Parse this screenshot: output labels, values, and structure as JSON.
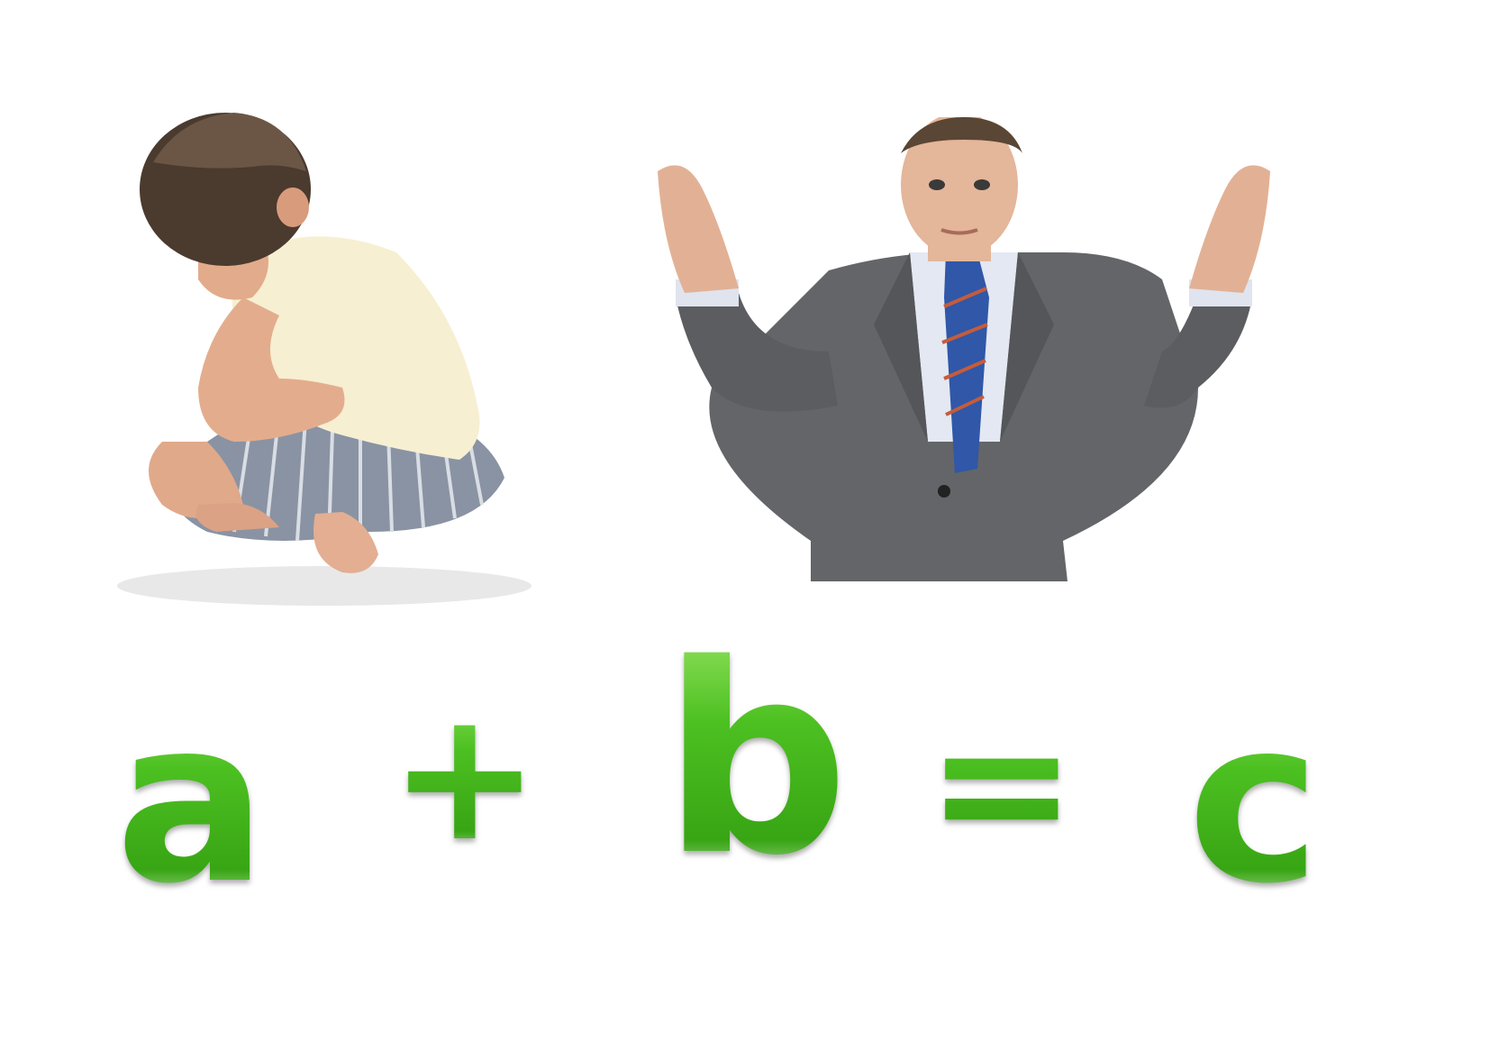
{
  "equation": {
    "a": "a",
    "plus": "+",
    "b": "b",
    "equals": "=",
    "c": "c"
  },
  "colors": {
    "symbol_green": "#3fae1f",
    "background": "#ffffff"
  },
  "images": {
    "left": "sitting-child-covering-face-photo",
    "right": "shrugging-businessman-photo"
  }
}
